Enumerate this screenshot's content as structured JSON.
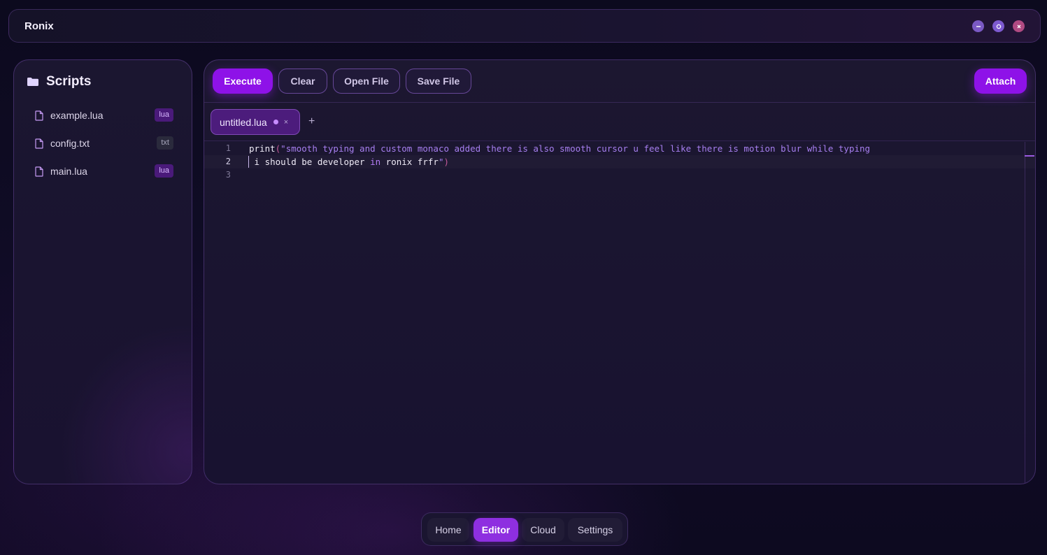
{
  "app": {
    "title": "Ronix",
    "window_controls": [
      {
        "name": "minimize",
        "icon": "minus-icon",
        "color": "#7a59c4"
      },
      {
        "name": "maximize",
        "icon": "circle-icon",
        "color": "#7d5ad0"
      },
      {
        "name": "close",
        "icon": "x-icon",
        "color": "#b04a82"
      }
    ]
  },
  "sidebar": {
    "title": "Scripts",
    "icon": "folder-icon",
    "files": [
      {
        "name": "example.lua",
        "ext": "lua"
      },
      {
        "name": "config.txt",
        "ext": "txt"
      },
      {
        "name": "main.lua",
        "ext": "lua"
      }
    ]
  },
  "toolbar": {
    "execute_label": "Execute",
    "clear_label": "Clear",
    "open_label": "Open File",
    "save_label": "Save File",
    "attach_label": "Attach"
  },
  "tabs": {
    "active": {
      "name": "untitled.lua",
      "modified": true,
      "close": "×"
    },
    "new_tab": "+"
  },
  "editor": {
    "lines": [
      {
        "num": "1",
        "fn": "print",
        "open": "(",
        "str": "\"smooth typing and custom monaco added there is also smooth cursor u feel like there is motion blur while typing"
      },
      {
        "num": "2",
        "pre": " i should be developer ",
        "kw": "in",
        "post": " ronix frfr",
        "str_close": "\"",
        "close": ")"
      },
      {
        "num": "3"
      }
    ],
    "current_line": 2
  },
  "nav": {
    "items": [
      "Home",
      "Editor",
      "Cloud",
      "Settings"
    ],
    "active": "Editor"
  },
  "colors": {
    "accent": "#8e12e8",
    "nav_active": "#8e2fe0",
    "string": "#a77ff0",
    "keyword": "#b37cf5"
  }
}
